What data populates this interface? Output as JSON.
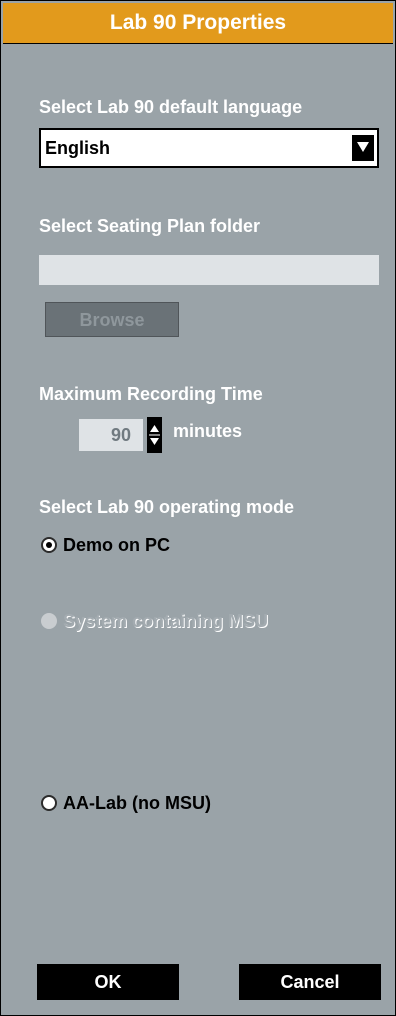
{
  "window": {
    "title": "Lab 90 Properties"
  },
  "language": {
    "label": "Select Lab 90 default language",
    "selected": "English",
    "dropdown_icon": "triangle-down-icon"
  },
  "seating_plan": {
    "label": "Select Seating Plan folder",
    "path": "",
    "browse_label": "Browse"
  },
  "recording": {
    "label": "Maximum Recording Time",
    "value": "90",
    "units": "minutes"
  },
  "mode": {
    "label": "Select Lab 90 operating mode",
    "options": [
      {
        "label": "Demo on PC",
        "selected": true,
        "enabled": true
      },
      {
        "label": "System containing MSU",
        "selected": false,
        "enabled": false
      },
      {
        "label": "AA-Lab (no MSU)",
        "selected": false,
        "enabled": true
      }
    ]
  },
  "buttons": {
    "ok": "OK",
    "cancel": "Cancel"
  },
  "colors": {
    "title_bar": "#e29a1c",
    "panel": "#9aa3a8"
  }
}
